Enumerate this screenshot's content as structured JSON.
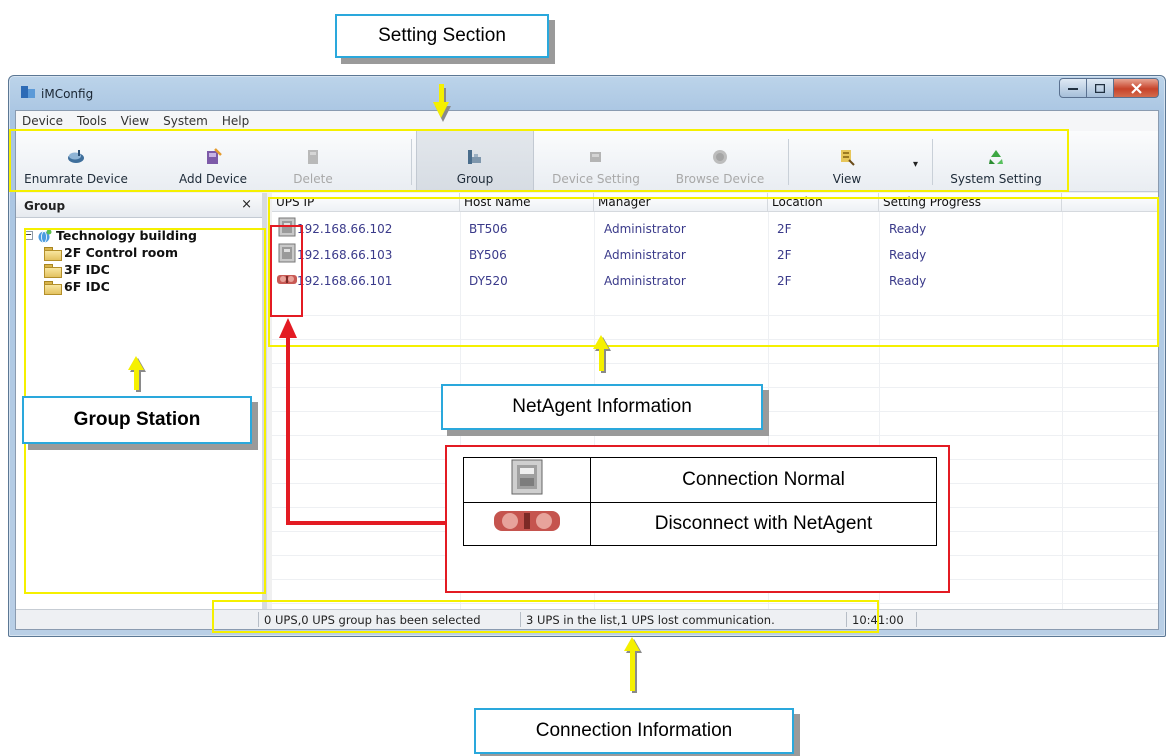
{
  "window": {
    "title": "iMConfig",
    "caption_buttons": [
      "minimize",
      "maximize",
      "close"
    ]
  },
  "menu": [
    "Device",
    "Tools",
    "View",
    "System",
    "Help"
  ],
  "toolbar": {
    "enumrate": "Enumrate Device",
    "add": "Add Device",
    "delete": "Delete",
    "group": "Group",
    "device_setting": "Device Setting",
    "browse_device": "Browse Device",
    "view": "View",
    "view_dropdown": "▾",
    "system_setting": "System Setting"
  },
  "group_pane": {
    "title": "Group",
    "close": "×",
    "root": "Technology building",
    "children": [
      "2F Control  room",
      "3F IDC",
      "6F IDC"
    ]
  },
  "list": {
    "columns": [
      "UPS IP",
      "Host Name",
      "Manager",
      "Location",
      "Setting Progress"
    ],
    "rows": [
      {
        "status": "connection-normal",
        "ip": "192.168.66.102",
        "host": "BT506",
        "manager": "Administrator",
        "location": "2F",
        "progress": "Ready"
      },
      {
        "status": "connection-normal",
        "ip": "192.168.66.103",
        "host": "BY506",
        "manager": "Administrator",
        "location": "2F",
        "progress": "Ready"
      },
      {
        "status": "disconnected",
        "ip": "192.168.66.101",
        "host": "DY520",
        "manager": "Administrator",
        "location": "2F",
        "progress": "Ready"
      }
    ]
  },
  "status_bar": {
    "selection": "0 UPS,0 UPS group has been selected",
    "summary": "3 UPS in the list,1 UPS  lost communication.",
    "time": "10:41:00"
  },
  "annotations": {
    "setting_section": "Setting Section",
    "group_station": "Group Station",
    "netagent_info": "NetAgent Information",
    "connection_info": "Connection Information",
    "legend_normal": "Connection Normal",
    "legend_disconnect": "Disconnect with NetAgent"
  },
  "colors": {
    "highlight_box": "#f5f000",
    "callout_border": "#2aa8dc",
    "legend_border": "#e31b23",
    "arrow_red": "#e31b23"
  }
}
